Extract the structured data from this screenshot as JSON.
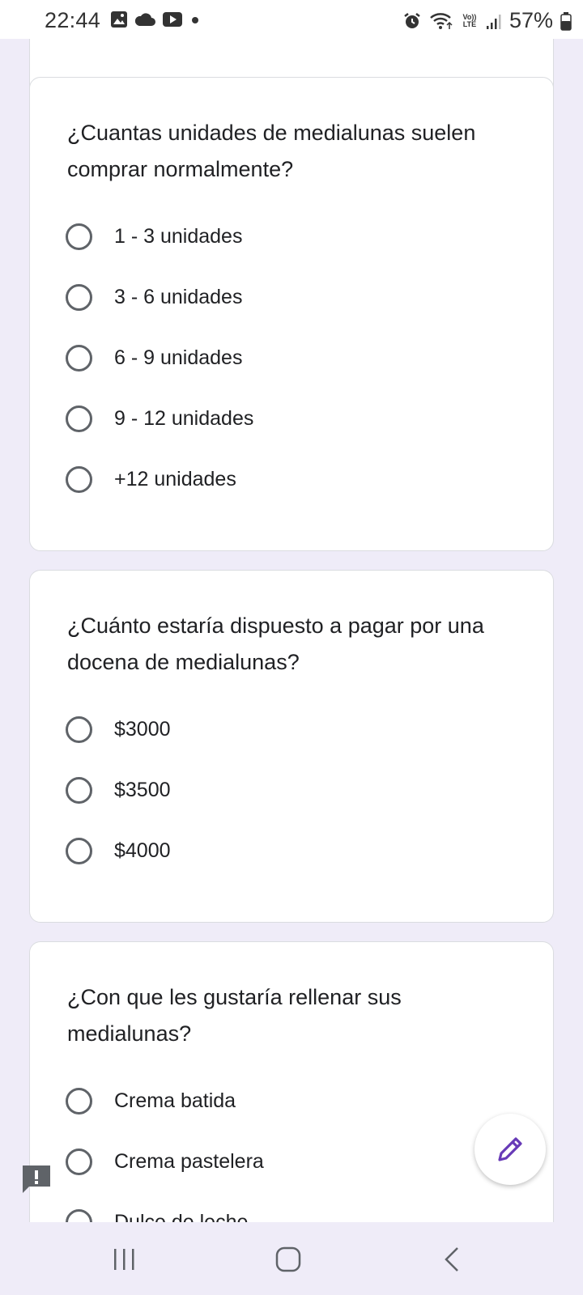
{
  "status_bar": {
    "time": "22:44",
    "battery_percent": "57%",
    "left_icons": [
      "gallery-icon",
      "cloud-icon",
      "youtube-icon",
      "dot-icon"
    ],
    "right_icons": [
      "alarm-icon",
      "wifi-icon",
      "volte-icon",
      "signal-icon",
      "battery-icon"
    ],
    "volte_text": "Vo)) LTE"
  },
  "questions": [
    {
      "title": "¿Cuantas unidades de medialunas suelen comprar normalmente?",
      "options": [
        "1 - 3 unidades",
        "3 - 6 unidades",
        "6 - 9 unidades",
        "9 - 12 unidades",
        "+12 unidades"
      ]
    },
    {
      "title": "¿Cuánto estaría dispuesto a pagar por una docena de medialunas?",
      "options": [
        "$3000",
        "$3500",
        "$4000"
      ]
    },
    {
      "title": "¿Con que les gustaría rellenar sus medialunas?",
      "options": [
        "Crema batida",
        "Crema pastelera",
        "Dulce de leche"
      ]
    }
  ],
  "colors": {
    "background": "#efecf8",
    "card": "#ffffff",
    "accent": "#673ab7",
    "radio_border": "#5f6368"
  },
  "fab": {
    "icon": "pencil-icon"
  },
  "feedback": {
    "icon": "report-feedback-icon"
  },
  "nav_bar": {
    "icons": [
      "recent-apps-icon",
      "home-icon",
      "back-icon"
    ]
  }
}
